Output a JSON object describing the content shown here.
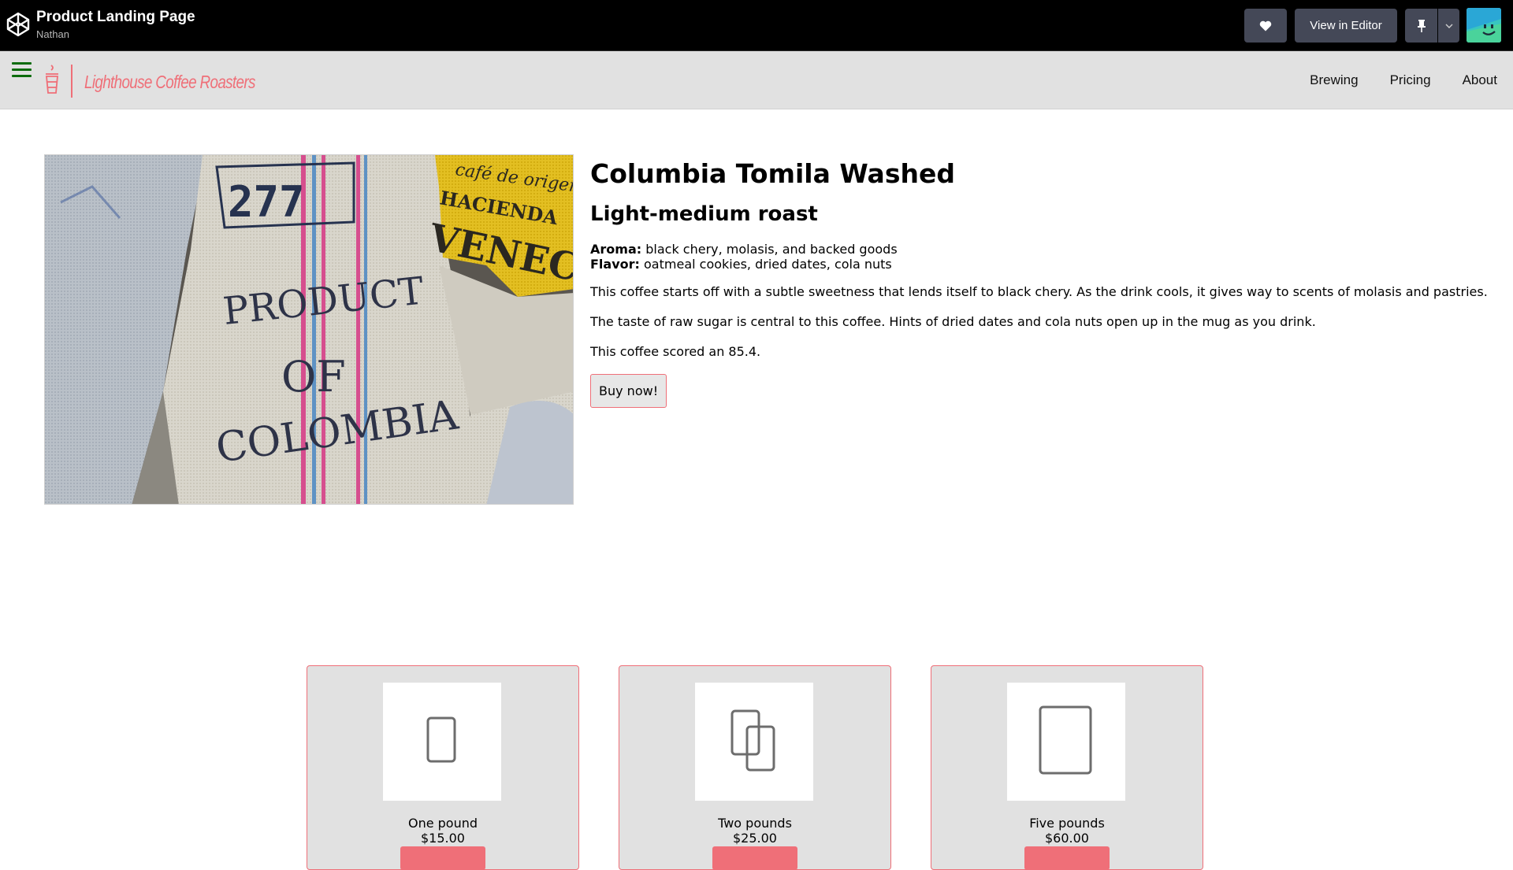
{
  "codepen": {
    "title": "Product Landing Page",
    "author": "Nathan",
    "editor_label": "View in Editor",
    "icons": [
      "codepen-logo-icon",
      "heart-icon",
      "pin-icon",
      "chevron-down-icon"
    ]
  },
  "site": {
    "brand": "Lighthouse Coffee Roasters",
    "nav": [
      "Brewing",
      "Pricing",
      "About"
    ]
  },
  "product": {
    "title": "Columbia Tomila Washed",
    "roast": "Light-medium roast",
    "aroma_label": "Aroma:",
    "aroma_text": "black chery, molasis, and backed goods",
    "flavor_label": "Flavor:",
    "flavor_text": "oatmeal cookies, dried dates, cola nuts",
    "paragraphs": [
      "This coffee starts off with a subtle sweetness that lends itself to black chery. As the drink cools, it gives way to scents of molasis and pastries.",
      "The taste of raw sugar is central to this coffee. Hints of dried dates and cola nuts open up in the mug as you drink.",
      "This coffee scored an 85.4."
    ],
    "buy_label": "Buy now!",
    "image_text": [
      "277",
      "PRODUCT",
      "OF",
      "COLOMBIA",
      "HACIENDA",
      "VENECIA",
      "café de origen"
    ]
  },
  "pricing": [
    {
      "name": "One pound",
      "price": "$15.00"
    },
    {
      "name": "Two pounds",
      "price": "$25.00"
    },
    {
      "name": "Five pounds",
      "price": "$60.00"
    }
  ],
  "colors": {
    "accent": "#ef6f78",
    "topbar": "#000000",
    "button": "#444857",
    "nav_bg": "#e1e1e1",
    "hamburger": "#0d6b0d"
  }
}
